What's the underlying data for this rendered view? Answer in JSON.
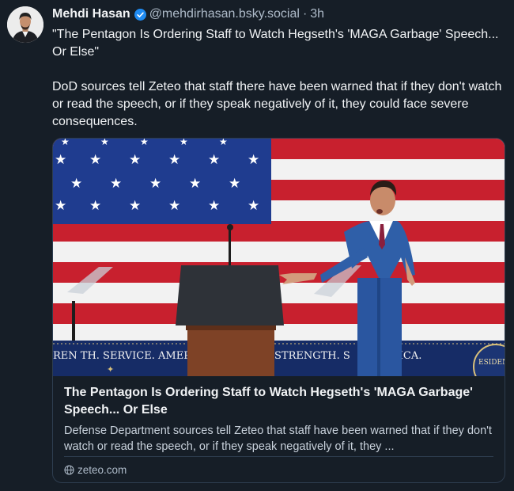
{
  "post": {
    "author_name": "Mehdi Hasan",
    "handle": "@mehdirhasan.bsky.social",
    "separator": "·",
    "timestamp": "3h",
    "text_lines": [
      "\"The Pentagon Is Ordering Staff to Watch Hegseth's 'MAGA Garbage' Speech... Or Else\"",
      "DoD sources tell Zeteo that staff there have been warned that if they don't watch or read the speech, or if they speak negatively of it, they could face severe consequences."
    ]
  },
  "card": {
    "title": "The Pentagon Is Ordering Staff to Watch Hegseth's 'MAGA Garbage' Speech... Or Else",
    "description": "Defense Department sources tell Zeteo that staff have been warned that if they don't watch or read the speech, or if they speak negatively of it, they ...",
    "domain": "zeteo.com",
    "image_banner_left": "REN  TH. SERVICE. AMERICA.",
    "image_banner_right_a": "STRENGTH. S",
    "image_banner_right_b": "RICA.",
    "image_seal_text": "ESIDENT OF"
  },
  "colors": {
    "background": "#161e27",
    "text": "#f1f3f5",
    "muted": "#aebbc9",
    "verified": "#1f8bf2",
    "border": "#2e3d4f"
  }
}
